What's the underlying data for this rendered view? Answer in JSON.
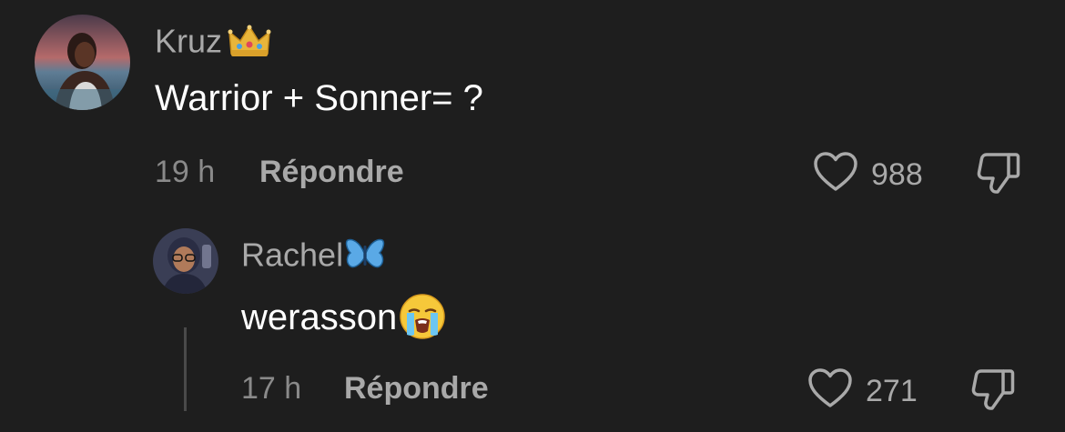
{
  "comments": [
    {
      "username": "Kruz",
      "text": "Warrior + Sonner= ?",
      "time": "19 h",
      "reply_label": "Répondre",
      "likes": "988",
      "username_emoji": "crown-icon"
    },
    {
      "username": "Rachel",
      "text": "werasson",
      "time": "17 h",
      "reply_label": "Répondre",
      "likes": "271",
      "username_emoji": "butterfly-icon",
      "text_emoji": "loudly-crying-face-icon"
    }
  ],
  "colors": {
    "background": "#1e1e1e",
    "username": "#a9a9a9",
    "text": "#ffffff",
    "meta": "#8a8a8a",
    "butterfly": "#5aa9e6",
    "crown": "#e8b53a"
  }
}
